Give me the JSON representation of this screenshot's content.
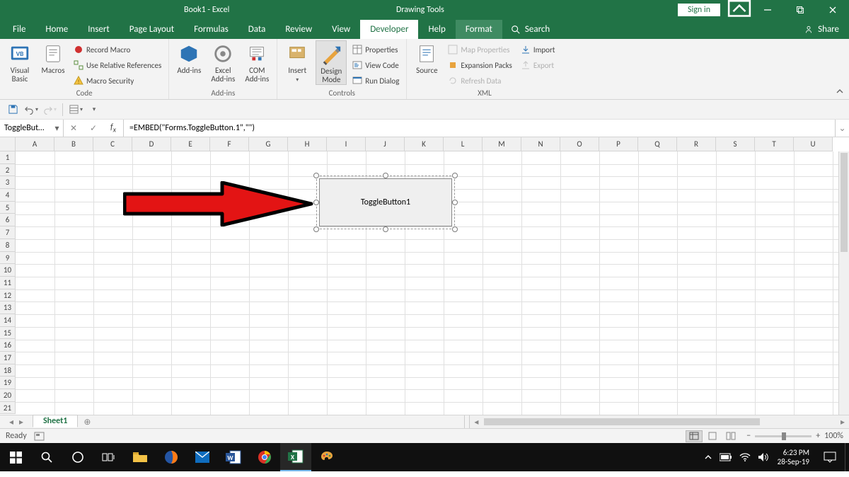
{
  "titlebar": {
    "doc_title": "Book1  -  Excel",
    "context_tab": "Drawing Tools",
    "signin": "Sign in"
  },
  "tabs": {
    "file": "File",
    "home": "Home",
    "insert": "Insert",
    "page_layout": "Page Layout",
    "formulas": "Formulas",
    "data": "Data",
    "review": "Review",
    "view": "View",
    "developer": "Developer",
    "help": "Help",
    "format": "Format",
    "search": "Search",
    "share": "Share"
  },
  "ribbon": {
    "code": {
      "visual_basic": "Visual Basic",
      "macros": "Macros",
      "record_macro": "Record Macro",
      "use_relative": "Use Relative References",
      "macro_security": "Macro Security",
      "group_label": "Code"
    },
    "addins": {
      "addins": "Add-ins",
      "excel_addins": "Excel Add-ins",
      "com_addins": "COM Add-ins",
      "group_label": "Add-ins"
    },
    "controls": {
      "insert": "Insert",
      "design_mode": "Design Mode",
      "properties": "Properties",
      "view_code": "View Code",
      "run_dialog": "Run Dialog",
      "group_label": "Controls"
    },
    "xml": {
      "source": "Source",
      "map_properties": "Map Properties",
      "expansion_packs": "Expansion Packs",
      "refresh_data": "Refresh Data",
      "import": "Import",
      "export": "Export",
      "group_label": "XML"
    }
  },
  "namebox": {
    "value": "ToggleBut…"
  },
  "formula_bar": {
    "value": "=EMBED(\"Forms.ToggleButton.1\",\"\")"
  },
  "columns": [
    "A",
    "B",
    "C",
    "D",
    "E",
    "F",
    "G",
    "H",
    "I",
    "J",
    "K",
    "L",
    "M",
    "N",
    "O",
    "P",
    "Q",
    "R",
    "S",
    "T",
    "U"
  ],
  "rows": [
    "1",
    "2",
    "3",
    "4",
    "5",
    "6",
    "7",
    "8",
    "9",
    "10",
    "11",
    "12",
    "13",
    "14",
    "15",
    "16",
    "17",
    "18",
    "19",
    "20",
    "21"
  ],
  "object": {
    "label": "ToggleButton1"
  },
  "sheet_tabs": {
    "sheet1": "Sheet1"
  },
  "statusbar": {
    "ready": "Ready",
    "zoom": "100%"
  },
  "taskbar": {
    "time": "6:23 PM",
    "date": "28-Sep-19"
  }
}
